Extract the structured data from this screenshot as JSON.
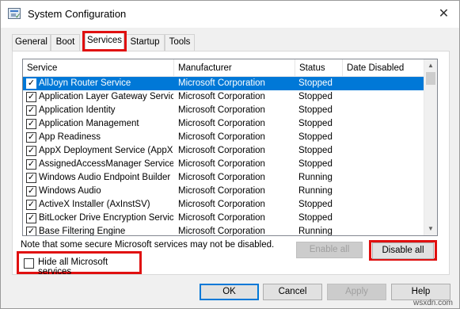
{
  "window": {
    "title": "System Configuration"
  },
  "tabs": [
    {
      "label": "General",
      "active": false
    },
    {
      "label": "Boot",
      "active": false
    },
    {
      "label": "Services",
      "active": true
    },
    {
      "label": "Startup",
      "active": false
    },
    {
      "label": "Tools",
      "active": false
    }
  ],
  "table": {
    "headers": {
      "service": "Service",
      "manufacturer": "Manufacturer",
      "status": "Status",
      "date_disabled": "Date Disabled"
    },
    "rows": [
      {
        "service": "AllJoyn Router Service",
        "manufacturer": "Microsoft Corporation",
        "status": "Stopped",
        "date": "",
        "checked": true,
        "selected": true
      },
      {
        "service": "Application Layer Gateway Service",
        "manufacturer": "Microsoft Corporation",
        "status": "Stopped",
        "date": "",
        "checked": true
      },
      {
        "service": "Application Identity",
        "manufacturer": "Microsoft Corporation",
        "status": "Stopped",
        "date": "",
        "checked": true
      },
      {
        "service": "Application Management",
        "manufacturer": "Microsoft Corporation",
        "status": "Stopped",
        "date": "",
        "checked": true
      },
      {
        "service": "App Readiness",
        "manufacturer": "Microsoft Corporation",
        "status": "Stopped",
        "date": "",
        "checked": true
      },
      {
        "service": "AppX Deployment Service (AppX...",
        "manufacturer": "Microsoft Corporation",
        "status": "Stopped",
        "date": "",
        "checked": true
      },
      {
        "service": "AssignedAccessManager Service",
        "manufacturer": "Microsoft Corporation",
        "status": "Stopped",
        "date": "",
        "checked": true
      },
      {
        "service": "Windows Audio Endpoint Builder",
        "manufacturer": "Microsoft Corporation",
        "status": "Running",
        "date": "",
        "checked": true
      },
      {
        "service": "Windows Audio",
        "manufacturer": "Microsoft Corporation",
        "status": "Running",
        "date": "",
        "checked": true
      },
      {
        "service": "ActiveX Installer (AxInstSV)",
        "manufacturer": "Microsoft Corporation",
        "status": "Stopped",
        "date": "",
        "checked": true
      },
      {
        "service": "BitLocker Drive Encryption Service",
        "manufacturer": "Microsoft Corporation",
        "status": "Stopped",
        "date": "",
        "checked": true
      },
      {
        "service": "Base Filtering Engine",
        "manufacturer": "Microsoft Corporation",
        "status": "Running",
        "date": "",
        "checked": true
      }
    ]
  },
  "note": "Note that some secure Microsoft services may not be disabled.",
  "buttons": {
    "enable_all": "Enable all",
    "disable_all": "Disable all",
    "ok": "OK",
    "cancel": "Cancel",
    "apply": "Apply",
    "help": "Help"
  },
  "hide_ms": {
    "label": "Hide all Microsoft services",
    "checked": false
  },
  "watermark": "wsxdn.com",
  "icons": {
    "close": "close-icon",
    "app": "msconfig-app-icon",
    "check": "checkmark-icon"
  },
  "colors": {
    "selection": "#0078d7",
    "highlight_box": "#e01010"
  }
}
